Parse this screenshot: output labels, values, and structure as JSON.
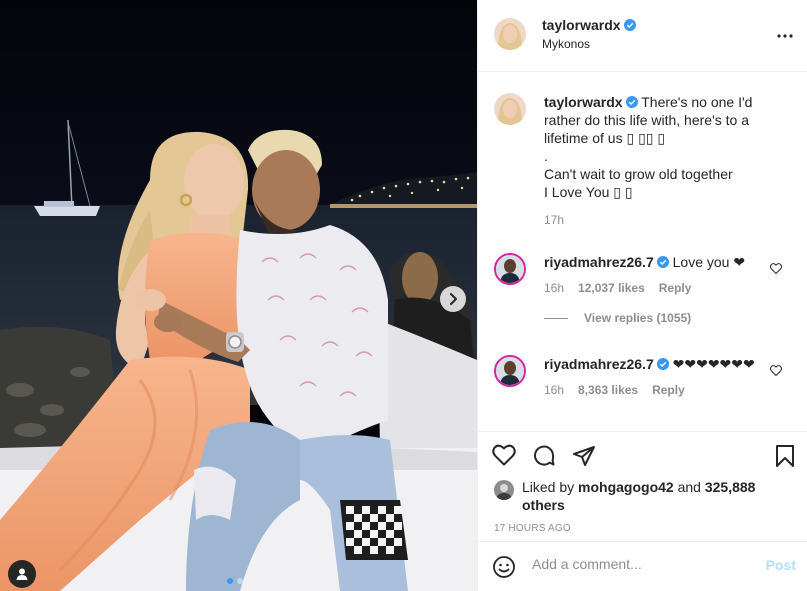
{
  "post": {
    "author": "taylorwardx",
    "location": "Mykonos",
    "caption_lines": [
      "There's no one I'd",
      "rather do this life with, here's to a",
      "lifetime of us ▯ ▯▯ ▯",
      ".",
      "Can't wait to grow old together",
      "I Love You ▯ ▯"
    ],
    "caption_time": "17h"
  },
  "comments": [
    {
      "username": "riyadmahrez26.7",
      "text": "Love you ❤",
      "time": "16h",
      "likes": "12,037 likes",
      "reply": "Reply",
      "view_replies": "View replies (1055)"
    },
    {
      "username": "riyadmahrez26.7",
      "text": "❤❤❤❤❤❤❤",
      "time": "16h",
      "likes": "8,363 likes",
      "reply": "Reply"
    }
  ],
  "likes": {
    "prefix": "Liked by",
    "user": "mohgagogo42",
    "and": "and",
    "others": "325,888 others"
  },
  "timestamp": "17 HOURS AGO",
  "add_comment": {
    "placeholder": "Add a comment...",
    "post_label": "Post"
  },
  "icons": {
    "more": "more-options-icon",
    "verified": "verified-badge-icon",
    "like": "heart-icon",
    "comment": "comment-icon",
    "share": "share-icon",
    "save": "bookmark-icon",
    "emoji": "emoji-icon",
    "next": "chevron-right-icon",
    "tag": "user-tag-icon"
  },
  "colors": {
    "verified": "#3897f0",
    "post_disabled": "#b2dffc",
    "dress": "#f5a77c"
  },
  "carousel": {
    "current": 1,
    "total": 2
  }
}
